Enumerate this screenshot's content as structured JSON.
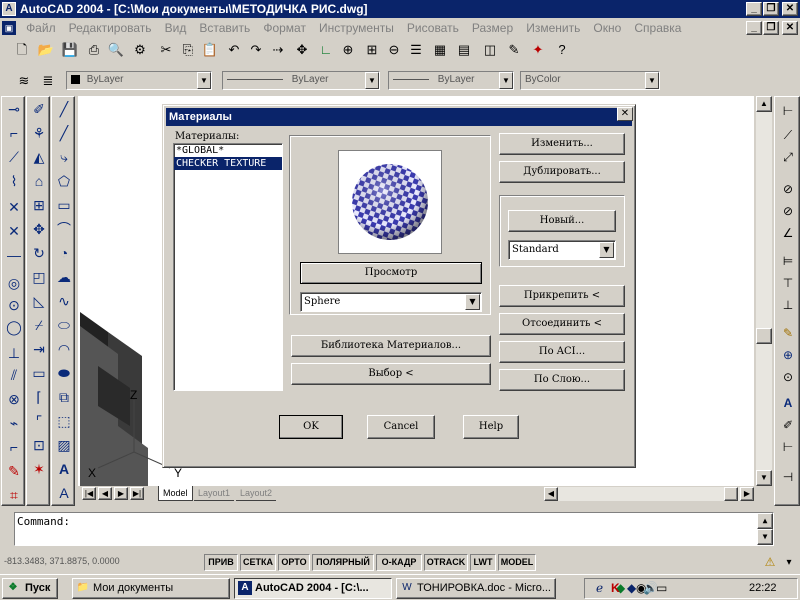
{
  "window": {
    "title": "AutoCAD 2004 - [C:\\Мои документы\\МЕТОДИЧКА РИС.dwg]",
    "app_icon": "A",
    "min": "_",
    "restore": "❐",
    "close": "✕"
  },
  "menu": [
    "Файл",
    "Редактировать",
    "Вид",
    "Вставить",
    "Формат",
    "Инструменты",
    "Рисовать",
    "Размер",
    "Изменить",
    "Окно",
    "Справка"
  ],
  "properties": {
    "layer_color": "ByLayer",
    "linetype": "ByLayer",
    "lineweight": "ByLayer",
    "plot_style": "ByColor"
  },
  "dialog": {
    "title": "Материалы",
    "close": "✕",
    "list_label": "Материалы:",
    "materials": [
      "*GLOBAL*",
      "CHECKER TEXTURE"
    ],
    "selected_material": "CHECKER TEXTURE",
    "preview_button": "Просмотр",
    "preview_shape": "Sphere",
    "library_button": "Библиотека Материалов...",
    "select_button": "Выбор <",
    "modify_button": "Изменить...",
    "duplicate_button": "Дублировать...",
    "new_button": "Новый...",
    "new_type": "Standard",
    "attach_button": "Прикрепить <",
    "detach_button": "Отсоединить <",
    "by_aci_button": "По ACI...",
    "by_layer_button": "По Слою...",
    "ok_button": "OK",
    "cancel_button": "Cancel",
    "help_button": "Help"
  },
  "ucs": {
    "x": "X",
    "y": "Y",
    "z": "Z"
  },
  "tabs": [
    "Model",
    "Layout1",
    "Layout2"
  ],
  "tab_nav": [
    "|◀",
    "◀",
    "▶",
    "▶|"
  ],
  "command": {
    "prompt": "Command:"
  },
  "status": {
    "coords": "-813.3483, 371.8875, 0.0000",
    "toggles": [
      "ПРИВ",
      "СЕТКА",
      "ОРТО",
      "ПОЛЯРНЫЙ",
      "О-КАДР",
      "OTRACK",
      "LWT",
      "MODEL"
    ]
  },
  "taskbar": {
    "start": "Пуск",
    "items": [
      {
        "label": "Мои документы",
        "icon": "folder-icon"
      },
      {
        "label": "AutoCAD 2004 - [C:\\...",
        "icon": "autocad-icon"
      },
      {
        "label": "ТОНИРОВКА.doc - Micro...",
        "icon": "word-icon"
      }
    ],
    "clock": "22:22"
  },
  "colors": {
    "titlebar": "#0a246a",
    "face": "#d4d0c8",
    "selection": "#0a246a",
    "checker": "#3b3bb0"
  }
}
